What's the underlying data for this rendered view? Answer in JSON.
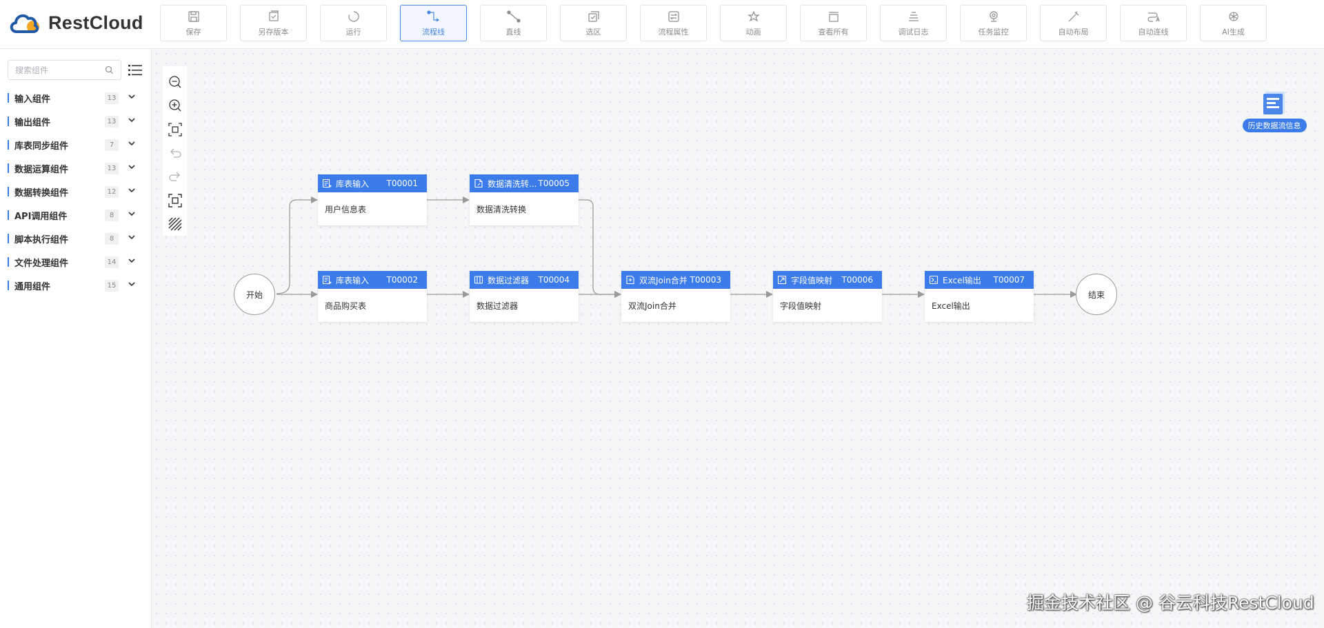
{
  "app": {
    "logo_text": "RestCloud"
  },
  "toolbar": [
    {
      "label": "保存",
      "icon": "save-icon"
    },
    {
      "label": "另存版本",
      "icon": "save-version-icon"
    },
    {
      "label": "运行",
      "icon": "run-icon"
    },
    {
      "label": "流程线",
      "icon": "flow-line-icon",
      "active": true
    },
    {
      "label": "直线",
      "icon": "straight-line-icon"
    },
    {
      "label": "选区",
      "icon": "select-area-icon"
    },
    {
      "label": "流程属性",
      "icon": "flow-properties-icon"
    },
    {
      "label": "动画",
      "icon": "animation-icon"
    },
    {
      "label": "查看所有",
      "icon": "view-all-icon"
    },
    {
      "label": "调试日志",
      "icon": "debug-log-icon"
    },
    {
      "label": "任务监控",
      "icon": "task-monitor-icon"
    },
    {
      "label": "自动布局",
      "icon": "auto-layout-icon"
    },
    {
      "label": "自动连线",
      "icon": "auto-connect-icon"
    },
    {
      "label": "AI生成",
      "icon": "ai-generate-icon"
    }
  ],
  "sidebar": {
    "search_placeholder": "搜索组件",
    "categories": [
      {
        "name": "输入组件",
        "count": "13"
      },
      {
        "name": "输出组件",
        "count": "13"
      },
      {
        "name": "库表同步组件",
        "count": "7"
      },
      {
        "name": "数据运算组件",
        "count": "13"
      },
      {
        "name": "数据转换组件",
        "count": "12"
      },
      {
        "name": "API调用组件",
        "count": "8"
      },
      {
        "name": "脚本执行组件",
        "count": "8"
      },
      {
        "name": "文件处理组件",
        "count": "14"
      },
      {
        "name": "通用组件",
        "count": "15"
      }
    ]
  },
  "canvas_tools": [
    "zoom-out-icon",
    "zoom-in-icon",
    "fit-view-icon",
    "undo-icon",
    "redo-icon",
    "fullscreen-icon",
    "grid-toggle-icon"
  ],
  "flow": {
    "start_label": "开始",
    "end_label": "结束",
    "nodes": [
      {
        "id": "T00001",
        "title": "库表输入",
        "body": "用户信息表",
        "icon": "table-input-icon"
      },
      {
        "id": "T00005",
        "title": "数据清洗转换",
        "title_display": "数据清洗转...",
        "body": "数据清洗转换",
        "icon": "data-clean-icon"
      },
      {
        "id": "T00002",
        "title": "库表输入",
        "body": "商品购买表",
        "icon": "table-input-icon"
      },
      {
        "id": "T00004",
        "title": "数据过滤器",
        "body": "数据过滤器",
        "icon": "data-filter-icon"
      },
      {
        "id": "T00003",
        "title": "双流Join合并",
        "body": "双流Join合并",
        "icon": "join-merge-icon"
      },
      {
        "id": "T00006",
        "title": "字段值映射",
        "body": "字段值映射",
        "icon": "field-map-icon"
      },
      {
        "id": "T00007",
        "title": "Excel输出",
        "body": "Excel输出",
        "icon": "excel-output-icon"
      }
    ]
  },
  "history_button": {
    "label": "历史数据流信息",
    "icon": "history-data-icon"
  },
  "watermark": "掘金技术社区 @ 谷云科技RestCloud",
  "colors": {
    "primary": "#3b7bea",
    "node_header": "#3b7bea",
    "edge": "#9a9a9a"
  }
}
